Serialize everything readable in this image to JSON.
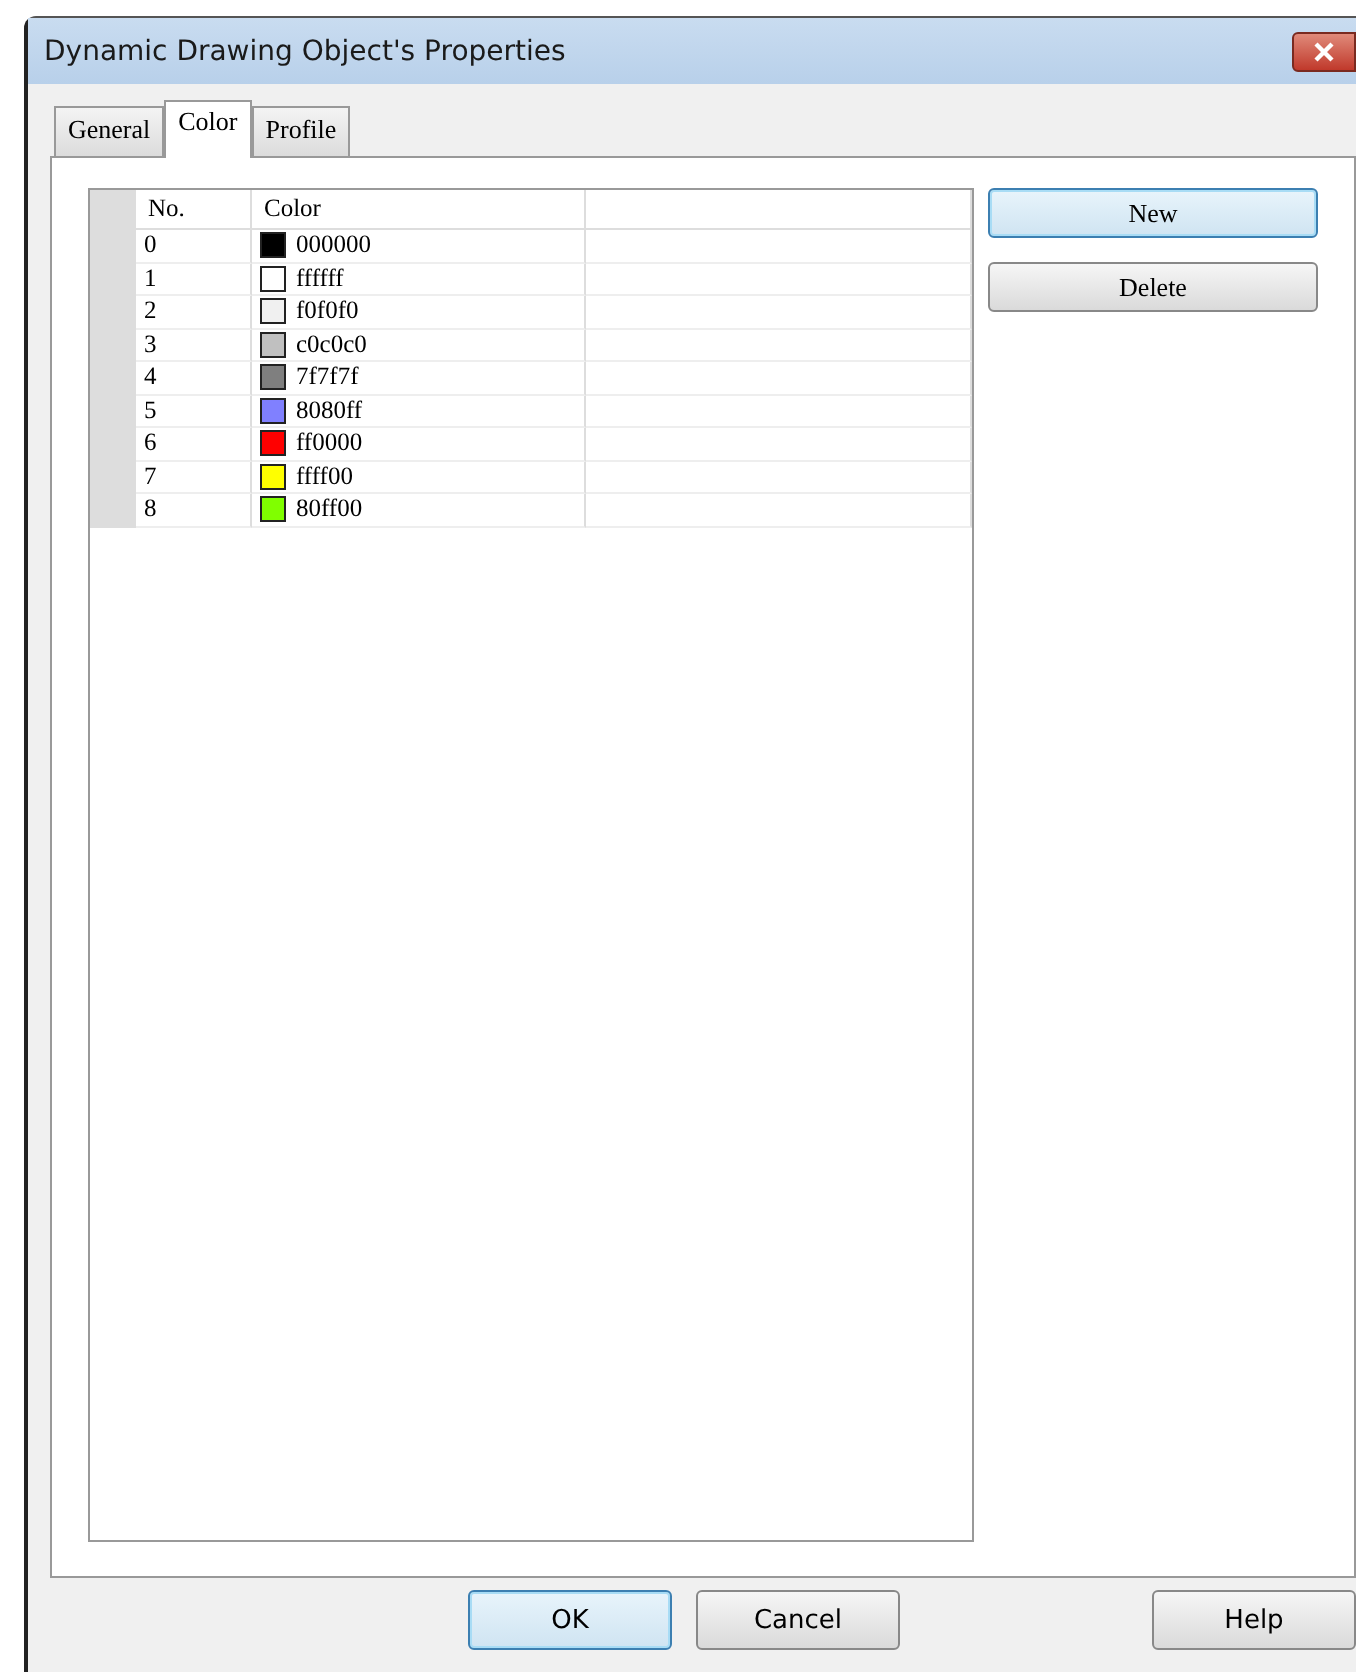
{
  "window": {
    "title": "Dynamic Drawing Object's Properties"
  },
  "tabs": [
    {
      "label": "General",
      "selected": false
    },
    {
      "label": "Color",
      "selected": true
    },
    {
      "label": "Profile",
      "selected": false
    }
  ],
  "table": {
    "columns": [
      "No.",
      "Color"
    ],
    "rows": [
      {
        "no": "0",
        "color": "#000000",
        "value": "000000"
      },
      {
        "no": "1",
        "color": "#ffffff",
        "value": "ffffff"
      },
      {
        "no": "2",
        "color": "#f0f0f0",
        "value": "f0f0f0"
      },
      {
        "no": "3",
        "color": "#c0c0c0",
        "value": "c0c0c0"
      },
      {
        "no": "4",
        "color": "#7f7f7f",
        "value": "7f7f7f"
      },
      {
        "no": "5",
        "color": "#8080ff",
        "value": "8080ff"
      },
      {
        "no": "6",
        "color": "#ff0000",
        "value": "ff0000"
      },
      {
        "no": "7",
        "color": "#ffff00",
        "value": "ffff00"
      },
      {
        "no": "8",
        "color": "#80ff00",
        "value": "80ff00"
      }
    ]
  },
  "side_buttons": [
    {
      "label": "New",
      "default": true
    },
    {
      "label": "Delete",
      "default": false
    }
  ],
  "footer_buttons": [
    {
      "label": "OK",
      "default": true
    },
    {
      "label": "Cancel",
      "default": false
    },
    {
      "label": "Help",
      "default": false
    }
  ]
}
